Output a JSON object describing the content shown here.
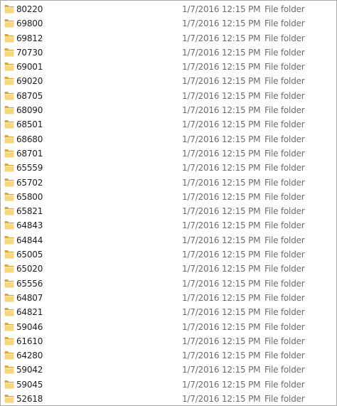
{
  "items": [
    {
      "name": "80220",
      "date_modified": "1/7/2016 12:15 PM",
      "type": "File folder"
    },
    {
      "name": "69800",
      "date_modified": "1/7/2016 12:15 PM",
      "type": "File folder"
    },
    {
      "name": "69812",
      "date_modified": "1/7/2016 12:15 PM",
      "type": "File folder"
    },
    {
      "name": "70730",
      "date_modified": "1/7/2016 12:15 PM",
      "type": "File folder"
    },
    {
      "name": "69001",
      "date_modified": "1/7/2016 12:15 PM",
      "type": "File folder"
    },
    {
      "name": "69020",
      "date_modified": "1/7/2016 12:15 PM",
      "type": "File folder"
    },
    {
      "name": "68705",
      "date_modified": "1/7/2016 12:15 PM",
      "type": "File folder"
    },
    {
      "name": "68090",
      "date_modified": "1/7/2016 12:15 PM",
      "type": "File folder"
    },
    {
      "name": "68501",
      "date_modified": "1/7/2016 12:15 PM",
      "type": "File folder"
    },
    {
      "name": "68680",
      "date_modified": "1/7/2016 12:15 PM",
      "type": "File folder"
    },
    {
      "name": "68701",
      "date_modified": "1/7/2016 12:15 PM",
      "type": "File folder"
    },
    {
      "name": "65559",
      "date_modified": "1/7/2016 12:15 PM",
      "type": "File folder"
    },
    {
      "name": "65702",
      "date_modified": "1/7/2016 12:15 PM",
      "type": "File folder"
    },
    {
      "name": "65800",
      "date_modified": "1/7/2016 12:15 PM",
      "type": "File folder"
    },
    {
      "name": "65821",
      "date_modified": "1/7/2016 12:15 PM",
      "type": "File folder"
    },
    {
      "name": "64843",
      "date_modified": "1/7/2016 12:15 PM",
      "type": "File folder"
    },
    {
      "name": "64844",
      "date_modified": "1/7/2016 12:15 PM",
      "type": "File folder"
    },
    {
      "name": "65005",
      "date_modified": "1/7/2016 12:15 PM",
      "type": "File folder"
    },
    {
      "name": "65020",
      "date_modified": "1/7/2016 12:15 PM",
      "type": "File folder"
    },
    {
      "name": "65556",
      "date_modified": "1/7/2016 12:15 PM",
      "type": "File folder"
    },
    {
      "name": "64807",
      "date_modified": "1/7/2016 12:15 PM",
      "type": "File folder"
    },
    {
      "name": "64821",
      "date_modified": "1/7/2016 12:15 PM",
      "type": "File folder"
    },
    {
      "name": "59046",
      "date_modified": "1/7/2016 12:15 PM",
      "type": "File folder"
    },
    {
      "name": "61610",
      "date_modified": "1/7/2016 12:15 PM",
      "type": "File folder"
    },
    {
      "name": "64280",
      "date_modified": "1/7/2016 12:15 PM",
      "type": "File folder"
    },
    {
      "name": "59042",
      "date_modified": "1/7/2016 12:15 PM",
      "type": "File folder"
    },
    {
      "name": "59045",
      "date_modified": "1/7/2016 12:15 PM",
      "type": "File folder"
    },
    {
      "name": "52618",
      "date_modified": "1/7/2016 12:15 PM",
      "type": "File folder"
    }
  ],
  "icons": {
    "item_icon": "folder-icon"
  },
  "colors": {
    "folder_front": "#f5d77d",
    "folder_back": "#d8a93a",
    "secondary_text": "#6d6d6d",
    "primary_text": "#1e1e1e"
  }
}
